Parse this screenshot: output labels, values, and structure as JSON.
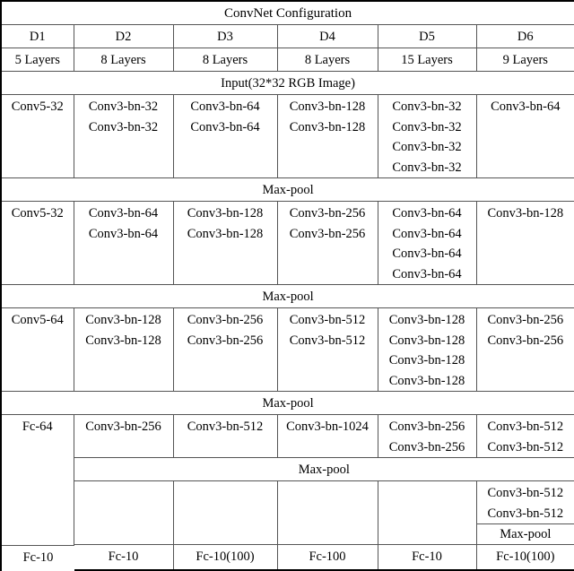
{
  "table": {
    "title": "ConvNet Configuration",
    "columns": [
      {
        "name": "D1",
        "layers": "5 Layers"
      },
      {
        "name": "D2",
        "layers": "8 Layers"
      },
      {
        "name": "D3",
        "layers": "8 Layers"
      },
      {
        "name": "D4",
        "layers": "8 Layers"
      },
      {
        "name": "D5",
        "layers": "15 Layers"
      },
      {
        "name": "D6",
        "layers": "9 Layers"
      }
    ],
    "input_row": "Input(32*32 RGB Image)",
    "maxpool_label": "Max-pool",
    "blocks": [
      {
        "cells": [
          [
            "Conv5-32"
          ],
          [
            "Conv3-bn-32",
            "Conv3-bn-32"
          ],
          [
            "Conv3-bn-64",
            "Conv3-bn-64"
          ],
          [
            "Conv3-bn-128",
            "Conv3-bn-128"
          ],
          [
            "Conv3-bn-32",
            "Conv3-bn-32",
            "Conv3-bn-32",
            "Conv3-bn-32"
          ],
          [
            "Conv3-bn-64"
          ]
        ]
      },
      {
        "cells": [
          [
            "Conv5-32"
          ],
          [
            "Conv3-bn-64",
            "Conv3-bn-64"
          ],
          [
            "Conv3-bn-128",
            "Conv3-bn-128"
          ],
          [
            "Conv3-bn-256",
            "Conv3-bn-256"
          ],
          [
            "Conv3-bn-64",
            "Conv3-bn-64",
            "Conv3-bn-64",
            "Conv3-bn-64"
          ],
          [
            "Conv3-bn-128"
          ]
        ]
      },
      {
        "cells": [
          [
            "Conv5-64"
          ],
          [
            "Conv3-bn-128",
            "Conv3-bn-128"
          ],
          [
            "Conv3-bn-256",
            "Conv3-bn-256"
          ],
          [
            "Conv3-bn-512",
            "Conv3-bn-512"
          ],
          [
            "Conv3-bn-128",
            "Conv3-bn-128",
            "Conv3-bn-128",
            "Conv3-bn-128"
          ],
          [
            "Conv3-bn-256",
            "Conv3-bn-256"
          ]
        ]
      }
    ],
    "fc_block": {
      "d1": "Fc-64",
      "cells": [
        [
          "Conv3-bn-256"
        ],
        [
          "Conv3-bn-512"
        ],
        [
          "Conv3-bn-1024"
        ],
        [
          "Conv3-bn-256",
          "Conv3-bn-256"
        ],
        [
          "Conv3-bn-512",
          "Conv3-bn-512"
        ]
      ]
    },
    "tail_block": {
      "d2": [],
      "d3": [],
      "d4": [],
      "d5": [],
      "d6": [
        "Conv3-bn-512",
        "Conv3-bn-512"
      ],
      "d6_maxpool": "Max-pool"
    },
    "final_row": [
      "Fc-10",
      "Fc-10",
      "Fc-10(100)",
      "Fc-100",
      "Fc-10",
      "Fc-10(100)"
    ]
  }
}
